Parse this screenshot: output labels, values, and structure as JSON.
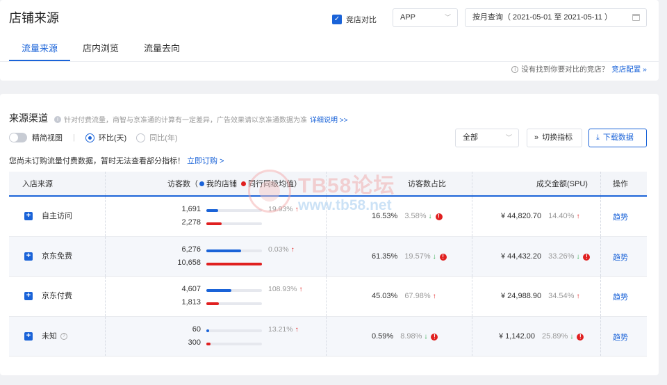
{
  "header": {
    "title": "店铺来源",
    "tabs": [
      {
        "label": "流量来源",
        "active": true
      },
      {
        "label": "店内浏览",
        "active": false
      },
      {
        "label": "流量去向",
        "active": false
      }
    ],
    "compare_label": "竞店对比",
    "platform_select": "APP",
    "date_select": "按月查询（ 2021-05-01 至 2021-05-11 ）",
    "config_hint": "没有找到你要对比的竞店？",
    "config_link": "竞店配置 »"
  },
  "section": {
    "title": "来源渠道",
    "desc": "针对付费流量，商智与京准通的计算有一定差异，广告效果请以京准通数据为准",
    "desc_link": "详细说明 >>",
    "simple_view_label": "精简视图",
    "radio_mom": "环比(天)",
    "radio_yoy": "同比(年)",
    "filter_select": "全部",
    "switch_btn": "切换指标",
    "download_btn": "下载数据",
    "notice": "您尚未订购流量付费数据，暂时无法查看部分指标！",
    "notice_link": "立即订购 >"
  },
  "table": {
    "headers": {
      "source": "入店来源",
      "visitors": "访客数（",
      "my_shop": "我的店铺",
      "peer_avg": "同行同级均值",
      "visitors_close": "）",
      "share": "访客数占比",
      "gmv": "成交金额(SPU)",
      "action": "操作"
    },
    "colors": {
      "my_shop": "#1a63d8",
      "peer": "#e02020"
    },
    "rows": [
      {
        "name": "自主访问",
        "has_help": false,
        "my": "1,691",
        "peer": "2,278",
        "my_frac": 0.21,
        "peer_frac": 0.28,
        "v_change": "19.93%",
        "v_dir": "up",
        "share": "16.53%",
        "share_change": "3.58%",
        "share_dir": "down",
        "share_warn": true,
        "gmv": "¥ 44,820.70",
        "gmv_change": "14.40%",
        "gmv_dir": "up",
        "gmv_warn": false,
        "action": "趋势"
      },
      {
        "name": "京东免费",
        "has_help": false,
        "my": "6,276",
        "peer": "10,658",
        "my_frac": 0.62,
        "peer_frac": 1.0,
        "v_change": "0.03%",
        "v_dir": "up",
        "share": "61.35%",
        "share_change": "19.57%",
        "share_dir": "down",
        "share_warn": true,
        "gmv": "¥ 44,432.20",
        "gmv_change": "33.26%",
        "gmv_dir": "down",
        "gmv_warn": true,
        "action": "趋势"
      },
      {
        "name": "京东付费",
        "has_help": false,
        "my": "4,607",
        "peer": "1,813",
        "my_frac": 0.45,
        "peer_frac": 0.22,
        "v_change": "108.93%",
        "v_dir": "up",
        "share": "45.03%",
        "share_change": "67.98%",
        "share_dir": "up",
        "share_warn": false,
        "gmv": "¥ 24,988.90",
        "gmv_change": "34.54%",
        "gmv_dir": "up",
        "gmv_warn": false,
        "action": "趋势"
      },
      {
        "name": "未知",
        "has_help": true,
        "my": "60",
        "peer": "300",
        "my_frac": 0.05,
        "peer_frac": 0.07,
        "v_change": "13.21%",
        "v_dir": "up",
        "share": "0.59%",
        "share_change": "8.98%",
        "share_dir": "down",
        "share_warn": true,
        "gmv": "¥ 1,142.00",
        "gmv_change": "25.89%",
        "gmv_dir": "down",
        "gmv_warn": true,
        "action": "趋势"
      }
    ]
  },
  "watermark": {
    "line1": "TB58论坛",
    "line2": "www.tb58.net"
  }
}
